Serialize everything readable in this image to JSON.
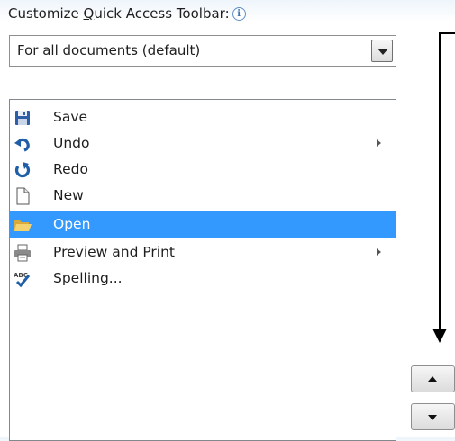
{
  "header": {
    "label_prefix": "Customize ",
    "label_accel": "Q",
    "label_suffix": "uick Access Toolbar:",
    "info_glyph": "i"
  },
  "scope_select": {
    "value": "For all documents (default)"
  },
  "commands": [
    {
      "label": "Save",
      "icon": "save-icon",
      "has_submenu": false,
      "selected": false
    },
    {
      "label": "Undo",
      "icon": "undo-icon",
      "has_submenu": true,
      "selected": false
    },
    {
      "label": "Redo",
      "icon": "redo-icon",
      "has_submenu": false,
      "selected": false
    },
    {
      "label": "New",
      "icon": "new-document-icon",
      "has_submenu": false,
      "selected": false
    },
    {
      "label": "Open",
      "icon": "open-folder-icon",
      "has_submenu": false,
      "selected": true
    },
    {
      "label": "Preview and Print",
      "icon": "print-icon",
      "has_submenu": true,
      "selected": false
    },
    {
      "label": "Spelling...",
      "icon": "spelling-icon",
      "has_submenu": false,
      "selected": false
    }
  ],
  "colors": {
    "selection": "#3399ff",
    "accent_blue": "#1f5fa8"
  }
}
